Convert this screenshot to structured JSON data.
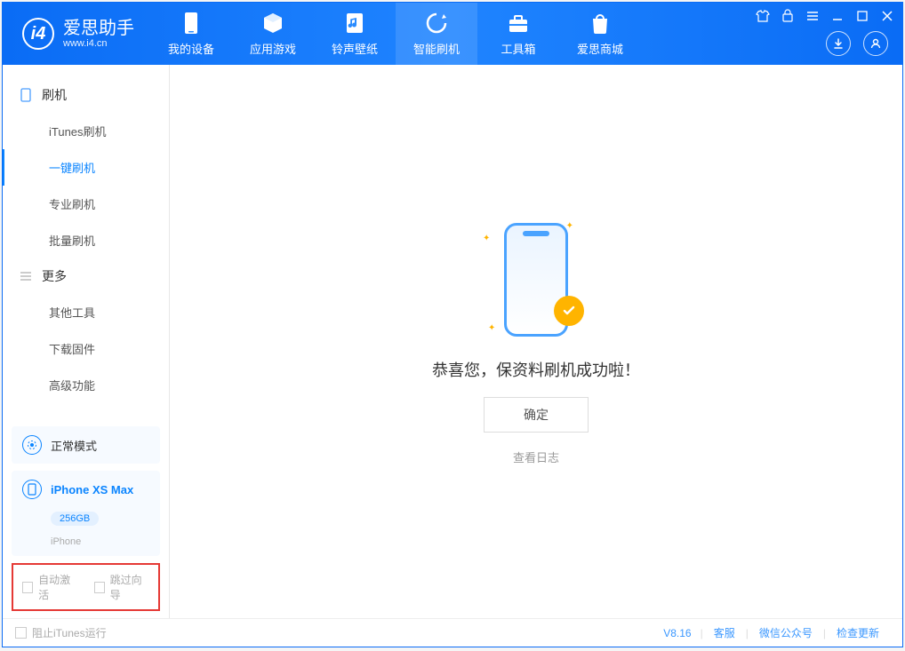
{
  "app": {
    "title": "爱思助手",
    "subtitle": "www.i4.cn"
  },
  "nav": {
    "items": [
      {
        "label": "我的设备"
      },
      {
        "label": "应用游戏"
      },
      {
        "label": "铃声壁纸"
      },
      {
        "label": "智能刷机"
      },
      {
        "label": "工具箱"
      },
      {
        "label": "爱思商城"
      }
    ]
  },
  "sidebar": {
    "group_flash": "刷机",
    "flash_items": [
      {
        "label": "iTunes刷机"
      },
      {
        "label": "一键刷机"
      },
      {
        "label": "专业刷机"
      },
      {
        "label": "批量刷机"
      }
    ],
    "group_more": "更多",
    "more_items": [
      {
        "label": "其他工具"
      },
      {
        "label": "下载固件"
      },
      {
        "label": "高级功能"
      }
    ],
    "mode_card": "正常模式",
    "device_card": {
      "name": "iPhone XS Max",
      "storage": "256GB",
      "type": "iPhone"
    },
    "options": {
      "auto_activate": "自动激活",
      "skip_guide": "跳过向导"
    }
  },
  "main": {
    "success_text": "恭喜您，保资料刷机成功啦！",
    "ok_button": "确定",
    "view_log": "查看日志"
  },
  "statusbar": {
    "block_itunes": "阻止iTunes运行",
    "version": "V8.16",
    "support": "客服",
    "wechat": "微信公众号",
    "update": "检查更新"
  }
}
